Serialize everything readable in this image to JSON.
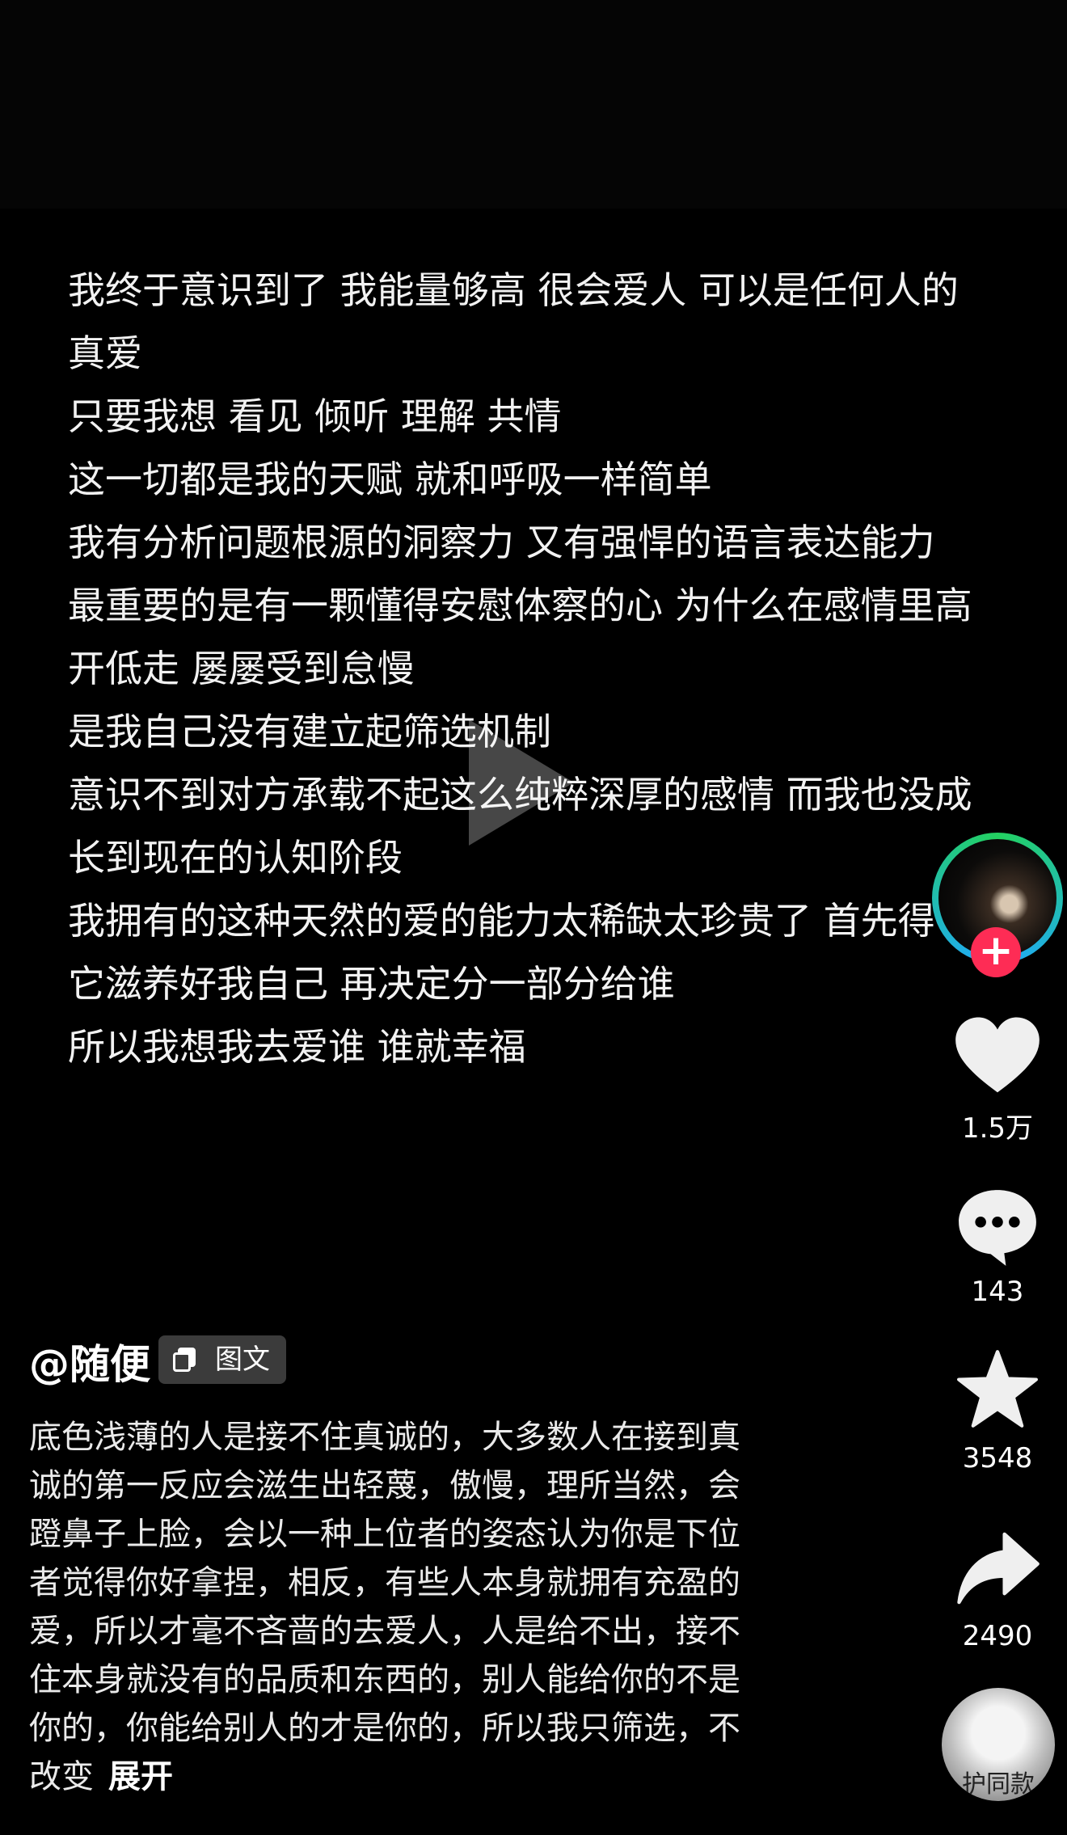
{
  "video": {
    "lines": [
      "我终于意识到了 我能量够高 很会爱人 可以是任何人的",
      "真爱",
      "只要我想 看见 倾听 理解 共情",
      "这一切都是我的天赋 就和呼吸一样简单",
      "我有分析问题根源的洞察力 又有强悍的语言表达能力",
      "最重要的是有一颗懂得安慰体察的心 为什么在感情里高",
      "开低走 屡屡受到怠慢",
      "是我自己没有建立起筛选机制",
      "意识不到对方承载不起这么纯粹深厚的感情 而我也没成",
      "长到现在的认知阶段",
      "我拥有的这种天然的爱的能力太稀缺太珍贵了 首先得",
      "它滋养好我自己 再决定分一部分给谁",
      "所以我想我去爱谁 谁就幸福"
    ]
  },
  "rail": {
    "follow_symbol": "+",
    "likes": "1.5万",
    "comments": "143",
    "favorites": "3548",
    "shares": "2490",
    "music_label": "护同款"
  },
  "caption": {
    "author": "@随便",
    "tag": "图文",
    "lines": [
      "底色浅薄的人是接不住真诚的，大多数人在接到真",
      "诚的第一反应会滋生出轻蔑，傲慢，理所当然，会",
      "蹬鼻子上脸，会以一种上位者的姿态认为你是下位",
      "者觉得你好拿捏，相反，有些人本身就拥有充盈的",
      "爱，所以才毫不吝啬的去爱人，人是给不出，接不",
      "住本身就没有的品质和东西的，别人能给你的不是",
      "你的，你能给别人的才是你的，所以我只筛选，不",
      "改变"
    ],
    "expand": "展开"
  },
  "colors": {
    "follow": "#fe2c55",
    "ring": "#23d160"
  }
}
